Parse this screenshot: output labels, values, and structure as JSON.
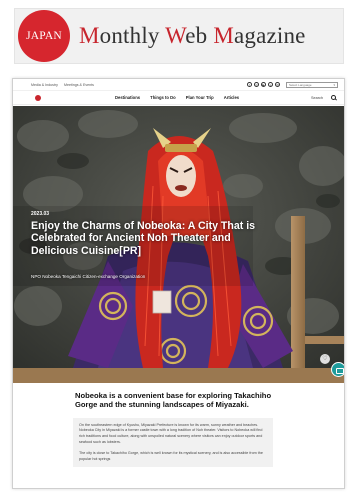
{
  "magazine": {
    "logo_text": "JAPAN",
    "title_parts": [
      {
        "text": "M",
        "red": true
      },
      {
        "text": "onthly ",
        "red": false
      },
      {
        "text": "W",
        "red": true
      },
      {
        "text": "eb ",
        "red": false
      },
      {
        "text": "M",
        "red": true
      },
      {
        "text": "agazine",
        "red": false
      }
    ]
  },
  "site": {
    "topbar_links": [
      "Media & Industry",
      "Meetings & Events"
    ],
    "social_icons": [
      "facebook-icon",
      "instagram-icon",
      "youtube-icon",
      "pinterest-icon",
      "newsletter-icon"
    ],
    "language_placeholder": "Select Language",
    "nav_items": [
      "Destinations",
      "Things to Do",
      "Plan Your Trip",
      "Articles"
    ],
    "search_label": "Search"
  },
  "hero": {
    "date": "2023.03",
    "title": "Enjoy the Charms of Nobeoka: A City That is Celebrated for Ancient Noh Theater and Delicious Cuisine[PR]",
    "organization": "NPO Nobeoka Tengaichi Citizen-exchange Organization"
  },
  "article": {
    "lead": "Nobeoka is a convenient base for exploring Takachiho Gorge and the stunning landscapes of Miyazaki.",
    "paragraphs": [
      "On the southeastern edge of Kyushu, Miyazaki Prefecture is known for its warm, sunny weather and beaches. Nobeoka City in Miyazaki is a former castle town with a long tradition of Noh theater. Visitors to Nobeoka will find rich traditions and food culture, along with unspoiled natural scenery where visitors can enjoy outdoor sports and seafood such as lobsters.",
      "The city is close to Takachiho Gorge, which is well known for its mystical scenery, and is also accessible from the popular hot springs"
    ]
  },
  "colors": {
    "brand_red": "#c7252d",
    "chat_teal": "#1e9b9b"
  }
}
